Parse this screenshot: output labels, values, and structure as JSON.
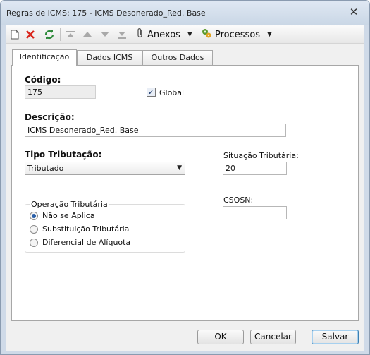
{
  "window": {
    "title": "Regras de ICMS: 175 - ICMS Desonerado_Red. Base",
    "close_glyph": "✕"
  },
  "toolbar": {
    "icons": [
      "new-document-icon",
      "delete-icon",
      "refresh-icon",
      "first-record-icon",
      "previous-record-icon",
      "next-record-icon",
      "last-record-icon"
    ],
    "anexos_label": "Anexos",
    "processos_label": "Processos",
    "caret": "▼"
  },
  "tabs": [
    {
      "label": "Identificação",
      "active": true
    },
    {
      "label": "Dados ICMS",
      "active": false
    },
    {
      "label": "Outros Dados",
      "active": false
    }
  ],
  "form": {
    "codigo_label": "Código:",
    "codigo_value": "175",
    "global_label": "Global",
    "global_checked": true,
    "check_glyph": "✓",
    "descricao_label": "Descrição:",
    "descricao_value": "ICMS Desonerado_Red. Base",
    "tipo_label": "Tipo Tributação:",
    "tipo_value": "Tributado",
    "select_arrow": "▼",
    "situacao_label": "Situação Tributária:",
    "situacao_value": "20",
    "csosn_label": "CSOSN:",
    "csosn_value": "",
    "operacao": {
      "title": "Operação Tributária",
      "options": [
        "Não se Aplica",
        "Substituição Tributária",
        "Diferencial de Alíquota"
      ],
      "selected": "Não se Aplica"
    }
  },
  "buttons": {
    "ok": "OK",
    "cancel": "Cancelar",
    "save": "Salvar"
  },
  "colors": {
    "highlight_ellipse": "#b21a1f",
    "delete": "#d9261c",
    "refresh": "#2d8a3a"
  }
}
